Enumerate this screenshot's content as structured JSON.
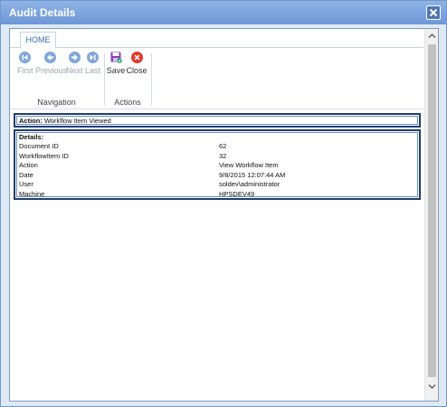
{
  "window": {
    "title": "Audit Details"
  },
  "ribbon": {
    "tab": "HOME",
    "navigation": {
      "label": "Navigation",
      "buttons": {
        "first": "First",
        "previous": "Previous",
        "next": "Next",
        "last": "Last"
      }
    },
    "actions": {
      "label": "Actions",
      "buttons": {
        "save": "Save",
        "close": "Close"
      }
    }
  },
  "action_panel": {
    "label": "Action:",
    "value": "Workflow Item Viewed"
  },
  "details_panel": {
    "title": "Details:",
    "rows": [
      {
        "key": "Document ID",
        "value": "62"
      },
      {
        "key": "WorkflowItem ID",
        "value": "32"
      },
      {
        "key": "Action",
        "value": "View Workflow Item"
      },
      {
        "key": "Date",
        "value": "9/8/2015 12:07:44 AM"
      },
      {
        "key": "User",
        "value": "soldev\\administrator"
      },
      {
        "key": "Machine",
        "value": "HPSDEV49"
      }
    ]
  },
  "colors": {
    "title_bar": "#6d98d6",
    "nav_icon": "#7fa6d8",
    "close_icon": "#e23b2e",
    "save_icon": "#8a3fb0",
    "panel_border": "#1f3f6d"
  },
  "icons": {
    "window_close": "close-icon",
    "first": "skip-back-icon",
    "previous": "arrow-left-icon",
    "next": "arrow-right-icon",
    "last": "skip-forward-icon",
    "save": "save-icon",
    "close": "close-circle-icon"
  }
}
